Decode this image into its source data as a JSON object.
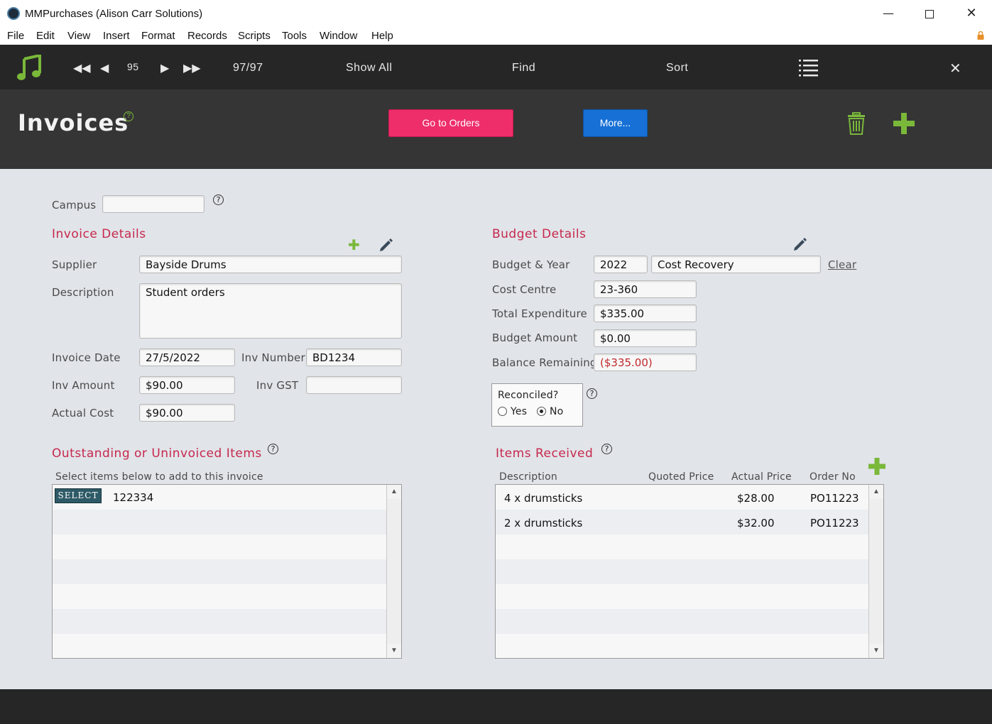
{
  "window": {
    "title": "MMPurchases (Alison Carr Solutions)"
  },
  "menu": [
    "File",
    "Edit",
    "View",
    "Insert",
    "Format",
    "Records",
    "Scripts",
    "Tools",
    "Window",
    "Help"
  ],
  "toolbar": {
    "record_number": "95",
    "record_count": "97/97",
    "show_all": "Show All",
    "find": "Find",
    "sort": "Sort"
  },
  "header": {
    "title": "Invoices",
    "help_glyph": "?",
    "go_to_orders": "Go to Orders",
    "more": "More..."
  },
  "campus": {
    "label": "Campus",
    "value": ""
  },
  "invoice_details": {
    "heading": "Invoice Details",
    "supplier_label": "Supplier",
    "supplier": "Bayside Drums",
    "description_label": "Description",
    "description": "Student orders",
    "invoice_date_label": "Invoice Date",
    "invoice_date": "27/5/2022",
    "inv_number_label": "Inv Number",
    "inv_number": "BD1234",
    "inv_amount_label": "Inv Amount",
    "inv_amount": "$90.00",
    "inv_gst_label": "Inv GST",
    "inv_gst": "",
    "actual_cost_label": "Actual Cost",
    "actual_cost": "$90.00"
  },
  "budget_details": {
    "heading": "Budget Details",
    "budget_year_label": "Budget & Year",
    "year": "2022",
    "budget": "Cost Recovery",
    "clear": "Clear",
    "cost_centre_label": "Cost Centre",
    "cost_centre": "23-360",
    "total_expenditure_label": "Total Expenditure",
    "total_expenditure": "$335.00",
    "budget_amount_label": "Budget Amount",
    "budget_amount": "$0.00",
    "balance_remaining_label": "Balance Remaining",
    "balance_remaining": "($335.00)"
  },
  "reconciled": {
    "label": "Reconciled?",
    "yes": "Yes",
    "no": "No",
    "selected": "No"
  },
  "outstanding": {
    "heading": "Outstanding or Uninvoiced Items",
    "instruction": "Select items below to add to this invoice",
    "rows": [
      {
        "button": "SELECT",
        "value": "122334"
      }
    ]
  },
  "items_received": {
    "heading": "Items Received",
    "columns": [
      "Description",
      "Quoted Price",
      "Actual Price",
      "Order No"
    ],
    "rows": [
      {
        "description": "4 x drumsticks",
        "quoted": "",
        "actual": "$28.00",
        "order": "PO11223"
      },
      {
        "description": "2 x drumsticks",
        "quoted": "",
        "actual": "$32.00",
        "order": "PO11223"
      }
    ]
  },
  "colors": {
    "accent_pink": "#ee2e6a",
    "accent_blue": "#1670d6",
    "section_red": "#c7284d",
    "green": "#7ab83a"
  }
}
